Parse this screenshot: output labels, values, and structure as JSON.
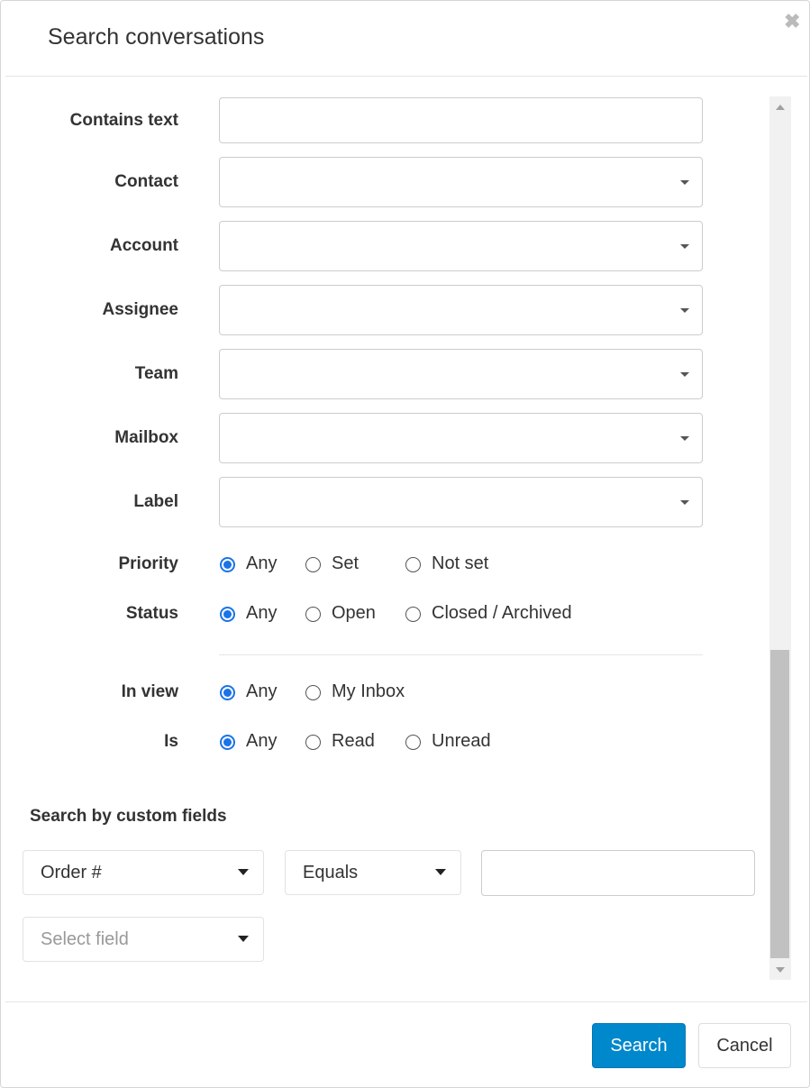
{
  "dialog": {
    "title": "Search conversations",
    "close_icon": "close-icon"
  },
  "fields": [
    {
      "label": "Contains text",
      "type": "text",
      "value": ""
    },
    {
      "label": "Contact",
      "type": "select",
      "value": ""
    },
    {
      "label": "Account",
      "type": "select",
      "value": ""
    },
    {
      "label": "Assignee",
      "type": "select",
      "value": ""
    },
    {
      "label": "Team",
      "type": "select",
      "value": ""
    },
    {
      "label": "Mailbox",
      "type": "select",
      "value": ""
    },
    {
      "label": "Label",
      "type": "select",
      "value": ""
    }
  ],
  "radios": [
    {
      "label": "Priority",
      "options": [
        "Any",
        "Set",
        "Not set"
      ],
      "selected": "Any"
    },
    {
      "label": "Status",
      "options": [
        "Any",
        "Open",
        "Closed / Archived"
      ],
      "selected": "Any"
    },
    {
      "label": "In view",
      "options": [
        "Any",
        "My Inbox"
      ],
      "selected": "Any"
    },
    {
      "label": "Is",
      "options": [
        "Any",
        "Read",
        "Unread"
      ],
      "selected": "Any"
    }
  ],
  "custom": {
    "heading": "Search by custom fields",
    "field": "Order #",
    "operator": "Equals",
    "value": "",
    "new_field_placeholder": "Select field"
  },
  "footer": {
    "search": "Search",
    "cancel": "Cancel"
  },
  "colors": {
    "primary": "#0088cc",
    "radio": "#1a73e8"
  }
}
